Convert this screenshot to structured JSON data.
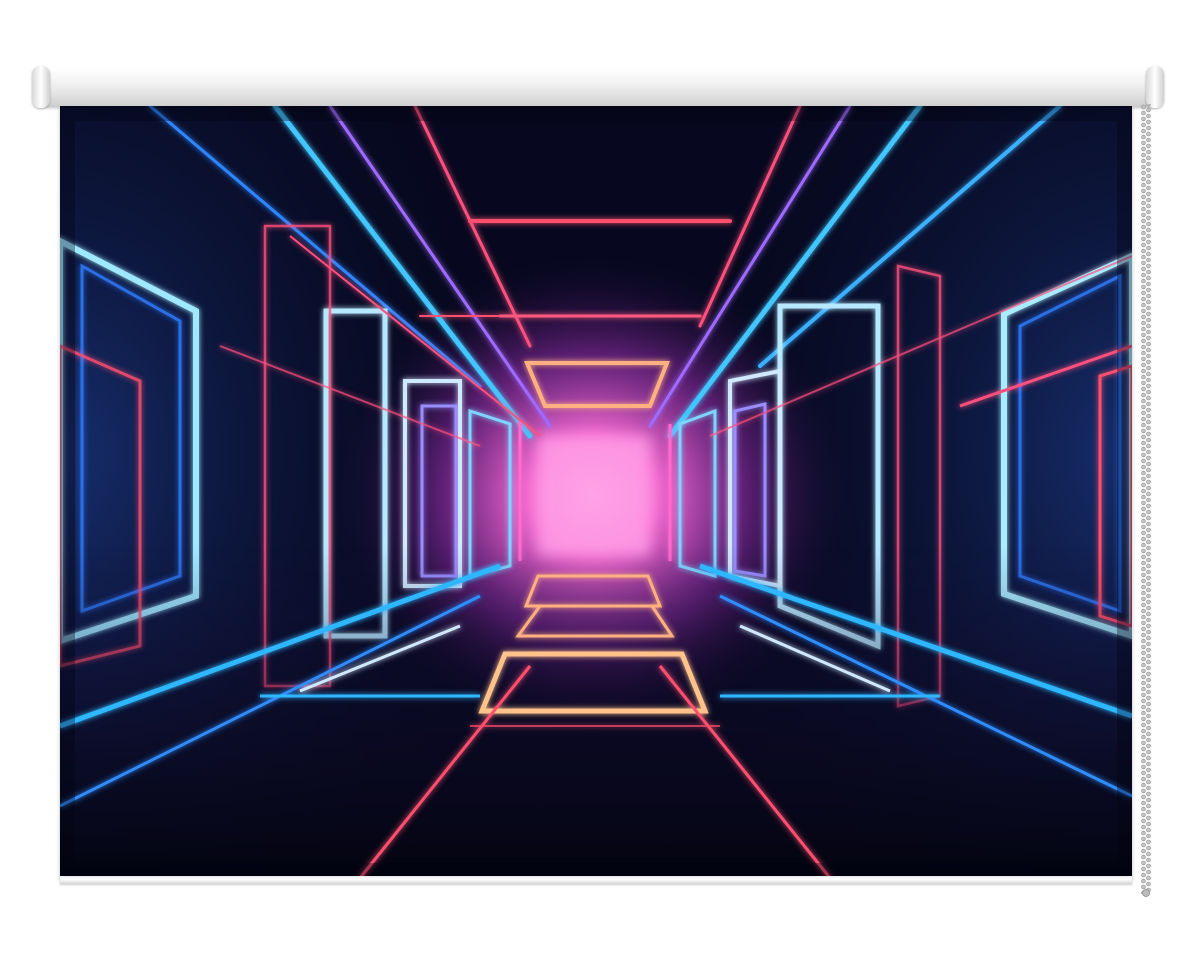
{
  "scene": {
    "subject": "roller-blind",
    "print": "neon-corridor",
    "colors": {
      "background": "#05071a",
      "glow_pink": "#ff5fd2",
      "neon_blue": "#2fb6ff",
      "neon_red": "#ff3d6e",
      "neon_orange": "#ffb070",
      "roller": "#f2f2f2",
      "chain": "#b8b8b8"
    }
  }
}
